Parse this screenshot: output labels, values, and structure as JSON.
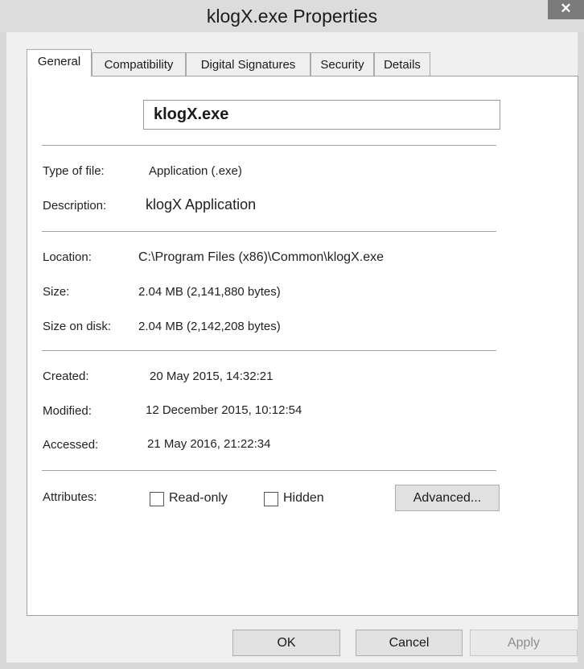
{
  "window": {
    "title": "klogX.exe Properties",
    "close_glyph": "✕"
  },
  "tabs": [
    {
      "label": "General",
      "active": true
    },
    {
      "label": "Compatibility",
      "active": false
    },
    {
      "label": "Digital Signatures",
      "active": false
    },
    {
      "label": "Security",
      "active": false
    },
    {
      "label": "Details",
      "active": false
    }
  ],
  "general": {
    "file_name": "klogX.exe",
    "type_label": "Type of file:",
    "type_value": "Application (.exe)",
    "description_label": "Description:",
    "description_value": "klogX Application",
    "location_label": "Location:",
    "location_value": "C:\\Program Files (x86)\\Common\\klogX.exe",
    "size_label": "Size:",
    "size_value": "2.04 MB (2,141,880 bytes)",
    "size_on_disk_label": "Size on disk:",
    "size_on_disk_value": "2.04 MB (2,142,208 bytes)",
    "created_label": "Created:",
    "created_value": "20 May 2015, 14:32:21",
    "modified_label": "Modified:",
    "modified_value": "12 December 2015, 10:12:54",
    "accessed_label": "Accessed:",
    "accessed_value": "21 May 2016, 21:22:34",
    "attributes_label": "Attributes:",
    "readonly_label": "Read-only",
    "readonly_checked": false,
    "hidden_label": "Hidden",
    "hidden_checked": false,
    "advanced_label": "Advanced..."
  },
  "footer": {
    "ok_label": "OK",
    "cancel_label": "Cancel",
    "apply_label": "Apply"
  }
}
